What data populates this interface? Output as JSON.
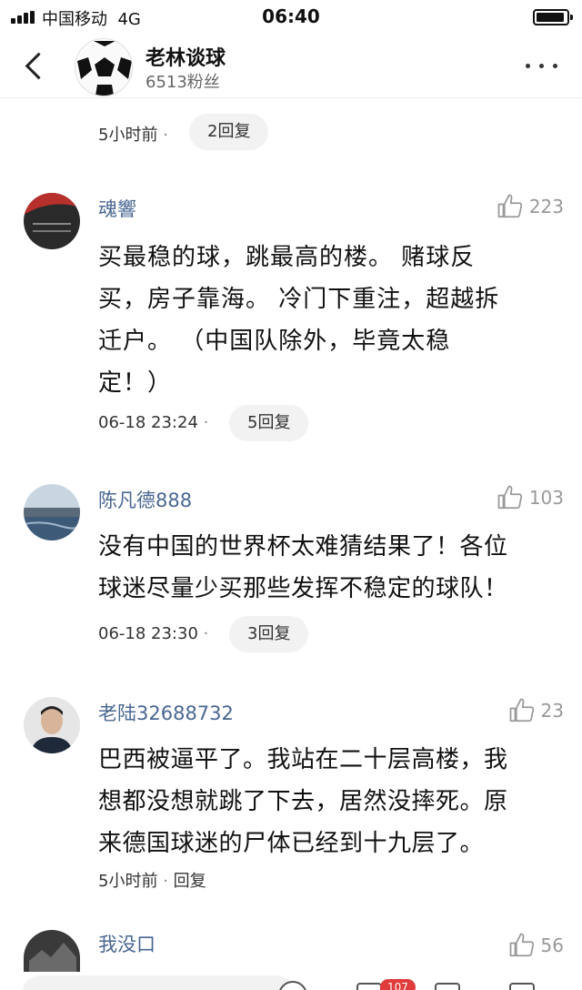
{
  "status_bar": {
    "carrier": "中国移动",
    "network": "4G",
    "time": "06:40"
  },
  "header": {
    "name": "老林谈球",
    "fans": "6513粉丝"
  },
  "top_meta": {
    "time": "5小时前",
    "separator": "·",
    "reply": "2回复"
  },
  "comments": [
    {
      "username": "魂響",
      "likes": "223",
      "lines": [
        "买最稳的球，跳最高的楼。 赌球反",
        "买，房子靠海。 冷门下重注，超越拆",
        "迁户。 （中国队除外，毕竟太稳",
        "定！）"
      ],
      "time": "06-18 23:24",
      "separator": "·",
      "reply": "5回复"
    },
    {
      "username": "陈凡德888",
      "likes": "103",
      "lines": [
        "没有中国的世界杯太难猜结果了！各位",
        "球迷尽量少买那些发挥不稳定的球队！"
      ],
      "time": "06-18 23:30",
      "separator": "·",
      "reply": "3回复"
    },
    {
      "username": "老陆32688732",
      "likes": "23",
      "lines": [
        "巴西被逼平了。我站在二十层高楼，我",
        "想都没想就跳了下去，居然没摔死。原",
        "来德国球迷的尸体已经到十九层了。"
      ],
      "time": "5小时前",
      "separator": "·",
      "reply": "回复"
    },
    {
      "username": "我没口",
      "likes": "56"
    }
  ],
  "bottom_bar": {
    "badge": "107"
  },
  "icons": {
    "back": "chevron-left-icon",
    "more": "more-dots-icon",
    "like": "thumbs-up-icon"
  },
  "colors": {
    "username": "#4a6792",
    "reply_pill": "#f2f2f2",
    "like": "#999999",
    "badge": "#e03c3c"
  }
}
